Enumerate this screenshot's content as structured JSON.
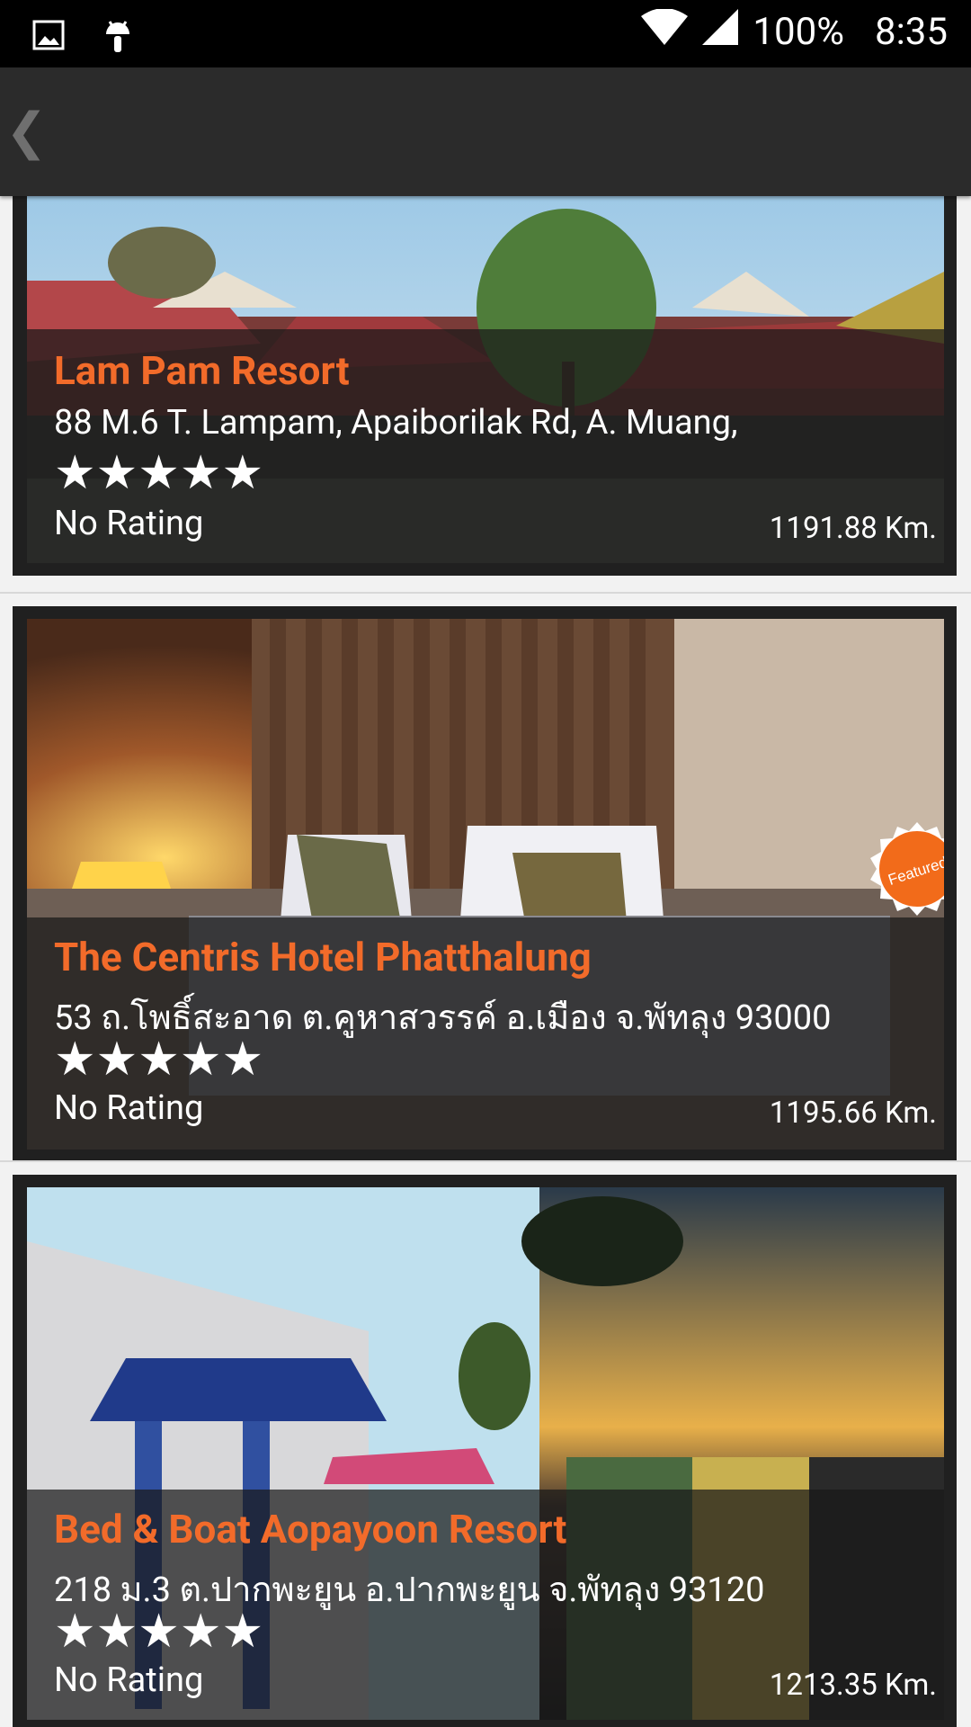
{
  "status_bar": {
    "battery": "100%",
    "time": "8:35",
    "icons": [
      "gallery-icon",
      "android-icon",
      "wifi-icon",
      "signal-icon"
    ]
  },
  "app_bar": {
    "back_glyph": "❮"
  },
  "listings": [
    {
      "name": "Lam Pam Resort",
      "address": "88 M.6 T. Lampam, Apaiborilak Rd, A. Muang,",
      "stars": "★★★★★",
      "rating": "No Rating",
      "distance": "1191.88 Km.",
      "featured": false
    },
    {
      "name": "The Centris Hotel Phatthalung",
      "address": "53 ถ.โพธิ์สะอาด ต.คูหาสวรรค์ อ.เมือง จ.พัทลุง 93000",
      "stars": "★★★★★",
      "rating": "No Rating",
      "distance": "1195.66 Km.",
      "featured": true,
      "featured_label": "Featured"
    },
    {
      "name": "Bed & Boat Aopayoon Resort",
      "address": "218 ม.3 ต.ปากพะยูน อ.ปากพะยูน จ.พัทลุง 93120",
      "stars": "★★★★★",
      "rating": "No Rating",
      "distance": "1213.35 Km.",
      "featured": false
    }
  ],
  "colors": {
    "accent": "#f26b2a",
    "app_bar": "#2b2b2b",
    "card_frame": "#202020"
  }
}
